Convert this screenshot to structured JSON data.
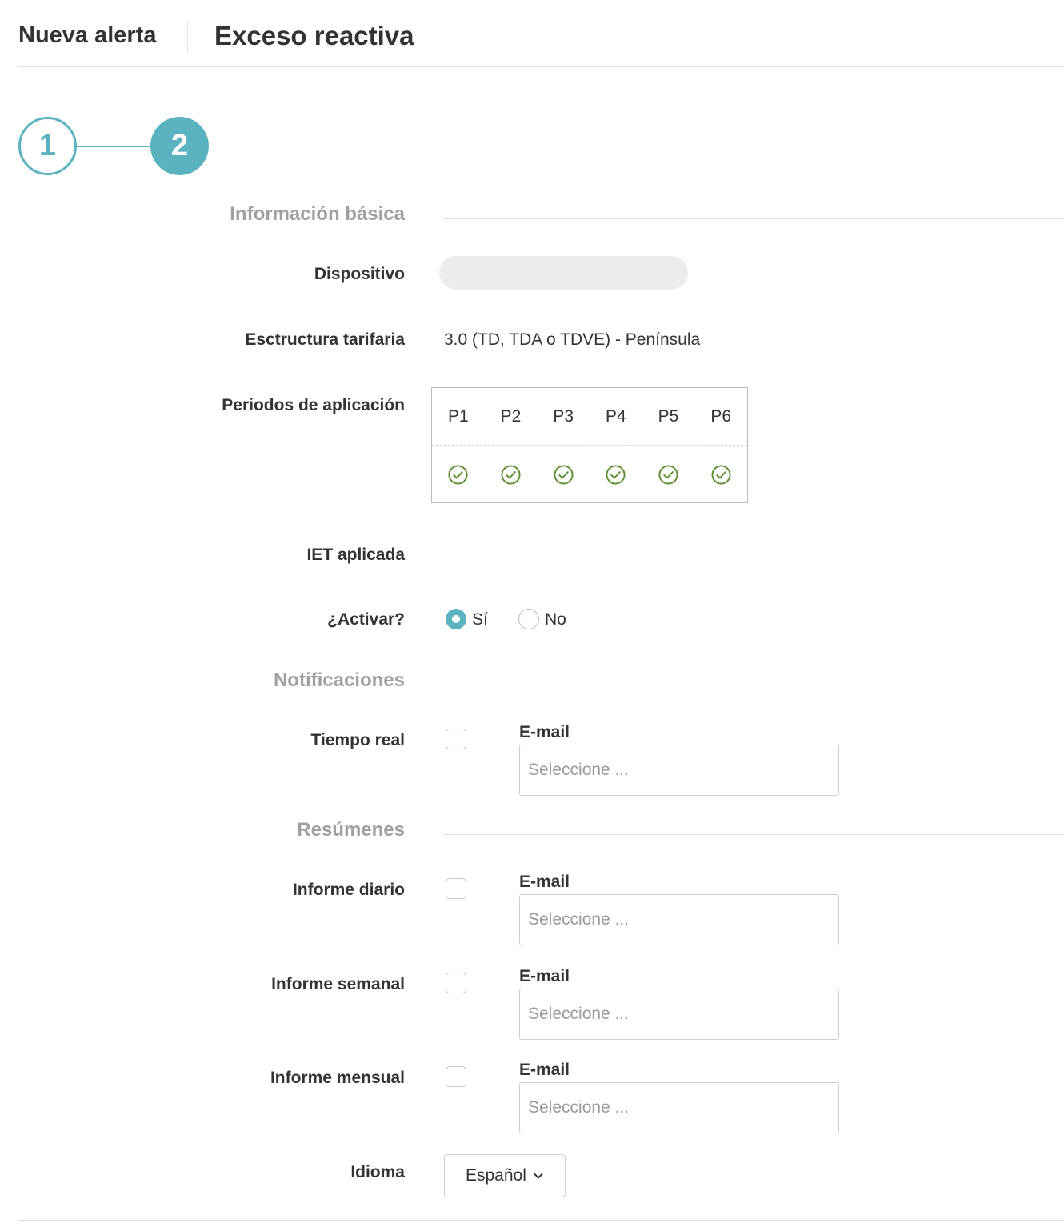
{
  "header": {
    "left_title": "Nueva alerta",
    "title": "Exceso reactiva"
  },
  "stepper": {
    "steps": [
      "1",
      "2"
    ],
    "current_step": 2
  },
  "basic_info": {
    "section_title": "Información básica",
    "device_label": "Dispositivo",
    "device_value": "",
    "tariff_label": "Esctructura tarifaria",
    "tariff_value": "3.0 (TD, TDA o TDVE) - Península",
    "periods_label": "Periodos de aplicación",
    "periods": [
      "P1",
      "P2",
      "P3",
      "P4",
      "P5",
      "P6"
    ],
    "periods_enabled": [
      true,
      true,
      true,
      true,
      true,
      true
    ],
    "iet_label": "IET aplicada",
    "activate_label": "¿Activar?",
    "activate_yes": "Sí",
    "activate_no": "No",
    "activate_selected": "yes"
  },
  "notifications": {
    "section_title": "Notificaciones",
    "realtime_label": "Tiempo real",
    "realtime_checked": false,
    "email_label": "E-mail",
    "email_placeholder": "Seleccione ..."
  },
  "summaries": {
    "section_title": "Resúmenes",
    "daily_label": "Informe diario",
    "weekly_label": "Informe semanal",
    "monthly_label": "Informe mensual",
    "email_label": "E-mail",
    "email_placeholder": "Seleccione ..."
  },
  "language": {
    "label": "Idioma",
    "selected": "Español"
  },
  "colors": {
    "accent": "#5ab3bf",
    "check_green": "#5b8f2e",
    "section_gray": "#a0a0a0"
  },
  "icons": {
    "period_check": "check-circle-icon",
    "language_chevron": "chevron-down-icon"
  }
}
